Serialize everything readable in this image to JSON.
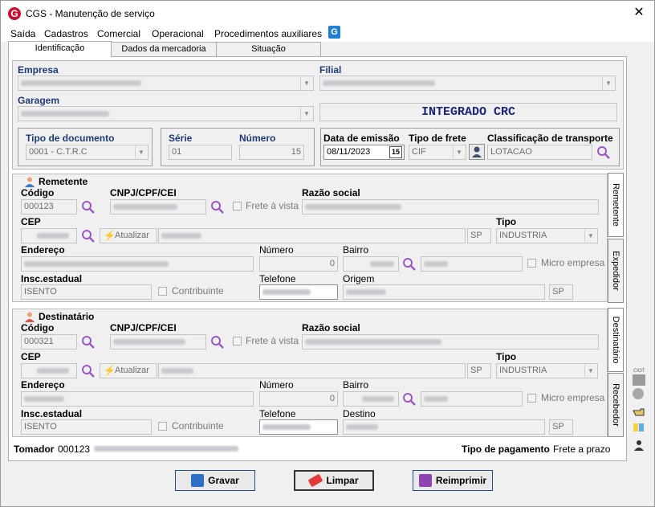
{
  "window": {
    "title": "CGS - Manutenção de serviço",
    "logo": "G",
    "close": "✕"
  },
  "menu": [
    "Saída",
    "Cadastros",
    "Comercial",
    "Operacional",
    "Procedimentos auxiliares"
  ],
  "menu_logo": "G",
  "tabs": [
    "Identificação",
    "Dados da mercadoria",
    "Situação"
  ],
  "top": {
    "empresa": "Empresa",
    "filial": "Filial",
    "garagem": "Garagem",
    "integrado": "INTEGRADO CRC"
  },
  "doc": {
    "tipo_label": "Tipo de documento",
    "tipo_value": "0001 - C.T.R.C",
    "serie_label": "Série",
    "serie_value": "01",
    "numero_label": "Número",
    "numero_value": "15"
  },
  "emissao": {
    "data_label": "Data de emissão",
    "data_value": "08/11/2023",
    "cal": "15",
    "frete_label": "Tipo de frete",
    "frete_value": "CIF",
    "class_label": "Classificação de transporte",
    "class_value": "LOTACAO"
  },
  "remetente": {
    "title": "Remetente",
    "codigo_label": "Código",
    "codigo_value": "000123",
    "cnpj_label": "CNPJ/CPF/CEI",
    "frete_vista": "Frete à vista",
    "razao_label": "Razão social",
    "cep_label": "CEP",
    "atualizar": "Atualizar",
    "uf": "SP",
    "tipo_label": "Tipo",
    "tipo_value": "INDUSTRIA",
    "endereco_label": "Endereço",
    "numero_label": "Número",
    "numero_value": "0",
    "bairro_label": "Bairro",
    "micro": "Micro empresa",
    "insc_label": "Insc.estadual",
    "insc_value": "ISENTO",
    "contribuinte": "Contribuinte",
    "telefone_label": "Telefone",
    "origem_label": "Origem",
    "origem_uf": "SP"
  },
  "destinatario": {
    "title": "Destinatário",
    "codigo_label": "Código",
    "codigo_value": "000321",
    "cnpj_label": "CNPJ/CPF/CEI",
    "frete_vista": "Frete à vista",
    "razao_label": "Razão social",
    "cep_label": "CEP",
    "atualizar": "Atualizar",
    "uf": "SP",
    "tipo_label": "Tipo",
    "tipo_value": "INDUSTRIA",
    "endereco_label": "Endereço",
    "numero_label": "Número",
    "numero_value": "0",
    "bairro_label": "Bairro",
    "micro": "Micro empresa",
    "insc_label": "Insc.estadual",
    "insc_value": "ISENTO",
    "contribuinte": "Contribuinte",
    "telefone_label": "Telefone",
    "destino_label": "Destino",
    "destino_uf": "SP"
  },
  "vtabs": [
    "Remetente",
    "Expedidor",
    "Destinatário",
    "Recebedor"
  ],
  "tomador": {
    "label": "Tomador",
    "value": "000123",
    "pag_label": "Tipo de pagamento",
    "pag_value": "Frete a prazo"
  },
  "buttons": {
    "gravar": "Gravar",
    "limpar": "Limpar",
    "reimprimir": "Reimprimir"
  },
  "side": {
    "ciot": "CIOT"
  },
  "colors": {
    "accent": "#1e3a78",
    "logo_red": "#c8102e",
    "logo_blue": "#1f7fd6",
    "search_icon": "#9b59c6"
  }
}
